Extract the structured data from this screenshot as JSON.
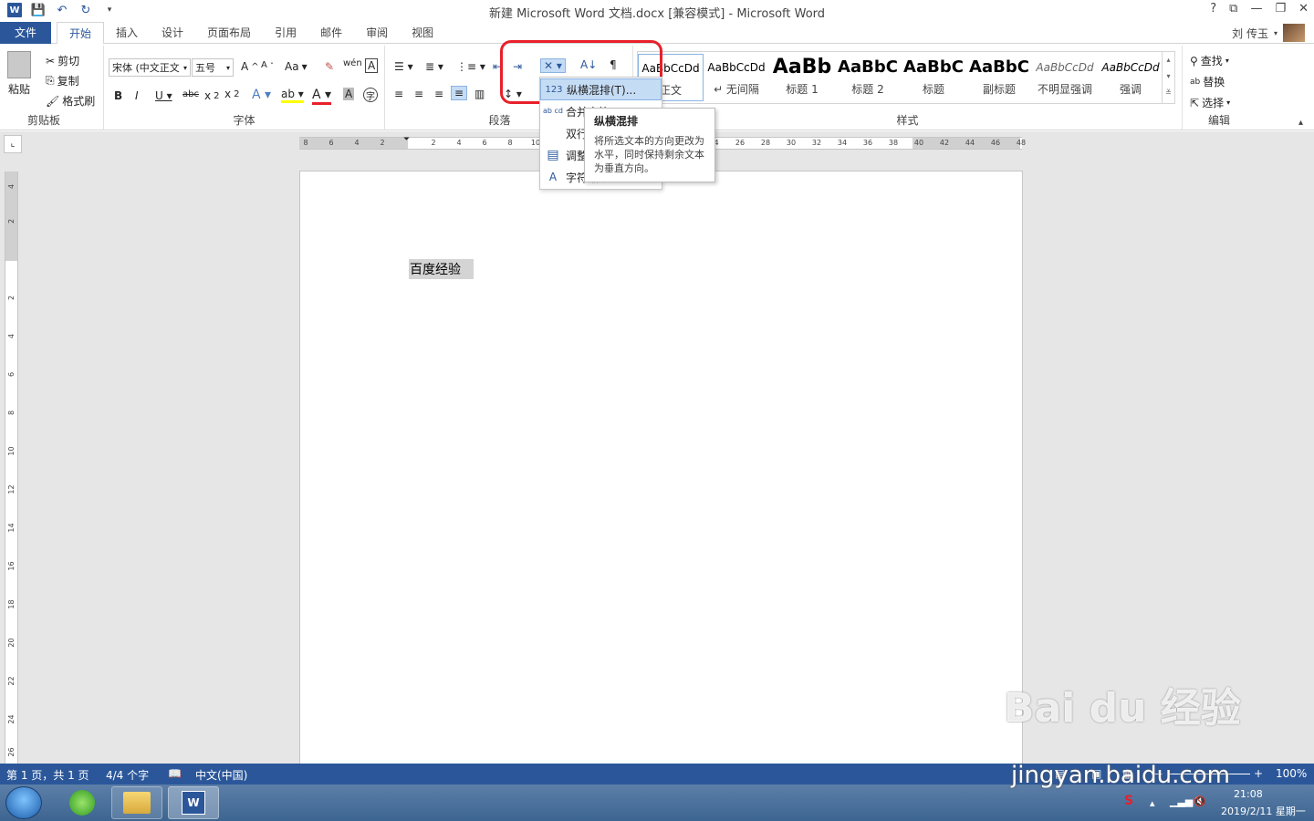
{
  "window": {
    "title": "新建 Microsoft Word 文档.docx [兼容模式] - Microsoft Word",
    "controls": [
      "?",
      "⧉",
      "—",
      "❐",
      "✕"
    ]
  },
  "tabs": {
    "file": "文件",
    "items": [
      "开始",
      "插入",
      "设计",
      "页面布局",
      "引用",
      "邮件",
      "审阅",
      "视图"
    ],
    "active": "开始",
    "user": "刘 传玉"
  },
  "clipboard": {
    "paste": "粘贴",
    "cut": "剪切",
    "copy": "复制",
    "format_painter": "格式刷",
    "label": "剪贴板"
  },
  "font": {
    "name": "宋体 (中文正文",
    "size": "五号",
    "label": "字体",
    "case_btn": "Aa"
  },
  "paragraph": {
    "label": "段落"
  },
  "styles": {
    "label": "样式",
    "items": [
      {
        "sample": "AaBbCcDd",
        "name": "正文"
      },
      {
        "sample": "AaBbCcDd",
        "name": "↵ 无间隔"
      },
      {
        "sample": "AaBb",
        "name": "标题 1"
      },
      {
        "sample": "AaBbC",
        "name": "标题 2"
      },
      {
        "sample": "AaBbC",
        "name": "标题"
      },
      {
        "sample": "AaBbC",
        "name": "副标题"
      },
      {
        "sample": "AaBbCcDd",
        "name": "不明显强调"
      },
      {
        "sample": "AaBbCcDd",
        "name": "强调"
      }
    ]
  },
  "editing": {
    "find": "查找",
    "replace": "替换",
    "select": "选择",
    "label": "编辑"
  },
  "asian_layout_menu": {
    "items": [
      {
        "icon": "123",
        "label": "纵横混排(T)..."
      },
      {
        "icon": "ab cd",
        "label": "合并字符"
      },
      {
        "icon": "",
        "label": "双行合一"
      },
      {
        "icon": "▤",
        "label": "调整宽度"
      },
      {
        "icon": "A",
        "label": "字符缩放"
      }
    ]
  },
  "tooltip": {
    "title": "纵横混排",
    "body": "将所选文本的方向更改为水平，同时保持剩余文本为垂直方向。"
  },
  "ruler": {
    "h_ticks": [
      "8",
      "6",
      "4",
      "2",
      "2",
      "4",
      "6",
      "8",
      "10",
      "4",
      "26",
      "28",
      "30",
      "32",
      "34",
      "36",
      "38",
      "40",
      "42",
      "44",
      "46",
      "48"
    ],
    "v_ticks": [
      "4",
      "2",
      "2",
      "4",
      "6",
      "8",
      "10",
      "12",
      "14",
      "16",
      "18",
      "20",
      "22",
      "24",
      "26"
    ]
  },
  "document": {
    "text": "百度经验"
  },
  "status": {
    "page": "第 1 页，共 1 页",
    "words": "4/4 个字",
    "language": "中文(中国)",
    "zoom": "100%"
  },
  "taskbar": {
    "time": "21:08",
    "date": "2019/2/11 星期一"
  },
  "watermark": {
    "brand": "Bai du 经验",
    "url": "jingyan.baidu.com"
  },
  "colors": {
    "accent": "#2b579a",
    "highlight_ring": "#e8202a"
  }
}
